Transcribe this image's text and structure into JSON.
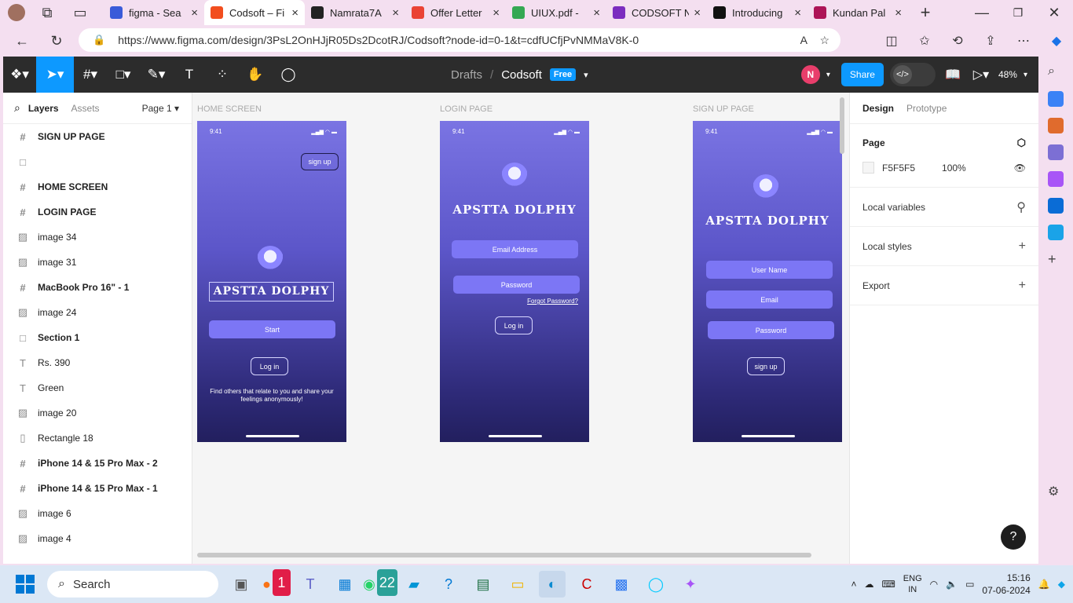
{
  "browser": {
    "tabs": [
      {
        "label": "figma - Sea",
        "color": "#3a5bd9",
        "active": false
      },
      {
        "label": "Codsoft – Fi",
        "color": "#f24e1e",
        "active": true
      },
      {
        "label": "Namrata7A",
        "color": "#222222",
        "active": false
      },
      {
        "label": "Offer Letter",
        "color": "#ea4335",
        "active": false
      },
      {
        "label": "UIUX.pdf - ",
        "color": "#34a853",
        "active": false
      },
      {
        "label": "CODSOFT N",
        "color": "#7b2cbf",
        "active": false
      },
      {
        "label": "Introducing",
        "color": "#111111",
        "active": false
      },
      {
        "label": "Kundan Pal",
        "color": "#ad1457",
        "active": false
      }
    ],
    "url": "https://www.figma.com/design/3PsL2OnHJjR05Ds2DcotRJ/Codsoft?node-id=0-1&t=cdfUCfjPvNMMaV8K-0"
  },
  "figma": {
    "breadcrumb": {
      "drafts": "Drafts",
      "separator": "/",
      "file": "Codsoft",
      "badge": "Free"
    },
    "avatar_initial": "N",
    "share_label": "Share",
    "zoom": "48%",
    "left_panel": {
      "layers_tab": "Layers",
      "assets_tab": "Assets",
      "page_select": "Page 1",
      "layers": [
        {
          "label": "SIGN UP PAGE",
          "icon": "#",
          "bold": true
        },
        {
          "label": "",
          "icon": "□",
          "bold": false
        },
        {
          "label": "HOME SCREEN",
          "icon": "#",
          "bold": true
        },
        {
          "label": "LOGIN PAGE",
          "icon": "#",
          "bold": true
        },
        {
          "label": "image 34",
          "icon": "▨",
          "bold": false
        },
        {
          "label": "image 31",
          "icon": "▨",
          "bold": false
        },
        {
          "label": "MacBook Pro 16\" - 1",
          "icon": "#",
          "bold": true
        },
        {
          "label": "image 24",
          "icon": "▨",
          "bold": false
        },
        {
          "label": "Section 1",
          "icon": "□",
          "bold": true
        },
        {
          "label": "Rs. 390",
          "icon": "T",
          "bold": false
        },
        {
          "label": "Green",
          "icon": "T",
          "bold": false
        },
        {
          "label": "image 20",
          "icon": "▨",
          "bold": false
        },
        {
          "label": "Rectangle 18",
          "icon": "▯",
          "bold": false
        },
        {
          "label": "iPhone 14 & 15 Pro Max - 2",
          "icon": "#",
          "bold": true
        },
        {
          "label": "iPhone 14 & 15 Pro Max - 1",
          "icon": "#",
          "bold": true
        },
        {
          "label": "image 6",
          "icon": "▨",
          "bold": false
        },
        {
          "label": "image 4",
          "icon": "▨",
          "bold": false
        }
      ]
    },
    "canvas": {
      "home": {
        "label": "HOME SCREEN",
        "time": "9:41",
        "signup": "sign up",
        "brand": "APSTTA DOLPHY",
        "start": "Start",
        "login": "Log in",
        "tagline": "Find others that relate to you and share your feelings anonymously!"
      },
      "login": {
        "label": "LOGIN PAGE",
        "time": "9:41",
        "brand": "APSTTA DOLPHY",
        "email": "Email Address",
        "password": "Password",
        "forgot": "Forgot Password?",
        "login": "Log in"
      },
      "signup": {
        "label": "SIGN UP PAGE",
        "time": "9:41",
        "brand": "APSTTA DOLPHY",
        "username": "User Name",
        "email": "Email",
        "password": "Password",
        "signup": "sign up"
      }
    },
    "right_panel": {
      "design_tab": "Design",
      "prototype_tab": "Prototype",
      "page_heading": "Page",
      "page_color": "F5F5F5",
      "page_opacity": "100%",
      "local_variables": "Local variables",
      "local_styles": "Local styles",
      "export": "Export",
      "help": "?"
    }
  },
  "taskbar": {
    "search_placeholder": "Search",
    "whatsapp_badge": "22",
    "notif_badge": "1",
    "lang_top": "ENG",
    "lang_bottom": "IN",
    "time": "15:16",
    "date": "07-06-2024"
  }
}
